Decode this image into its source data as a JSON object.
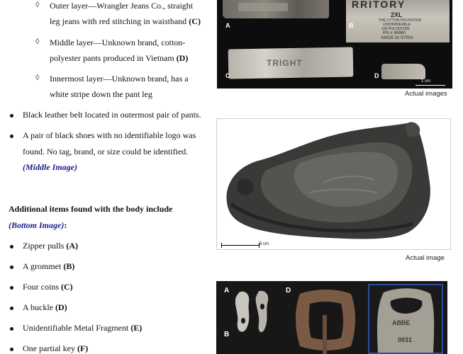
{
  "layers": [
    {
      "line1": "Outer layer—Wrangler Jeans Co., straight",
      "line2": "leg jeans with red stitching in waistband ",
      "ref": "(C)"
    },
    {
      "line1": "Middle layer—Unknown brand, cotton-",
      "line2": "polyester pants produced in Vietnam ",
      "ref": "(D)"
    },
    {
      "line1": "Innermost layer—Unknown brand, has a",
      "line2": "white stripe down the pant leg",
      "ref": ""
    }
  ],
  "belt": "Black leather belt located in outermost pair of pants.",
  "shoes": {
    "line1": "A pair of black shoes with no identifiable logo was",
    "line2": "found. No tag, brand, or size could be identified.",
    "ref": "(Middle Image)"
  },
  "additional": {
    "heading": "Additional items found with the body include",
    "ref": "(Bottom Image)",
    "colon": ":"
  },
  "items": [
    {
      "text": "Zipper pulls ",
      "ref": "(A)"
    },
    {
      "text": "A grommet ",
      "ref": "(B)"
    },
    {
      "text": "Four coins ",
      "ref": "(C)"
    },
    {
      "text": "A buckle ",
      "ref": "(D)"
    },
    {
      "text": "Unidentifiable Metal Fragment ",
      "ref": "(E)"
    },
    {
      "text": "One partial key ",
      "ref": "(F)"
    }
  ],
  "top_image": {
    "panels": [
      "A",
      "B",
      "C",
      "D"
    ],
    "tag_text": {
      "b1": "RRITORY",
      "b2": "2XL",
      "b3": "THE LITTON POLYESTER",
      "b4": "UNSHRINKABLE",
      "b5": "100 POLYESTER",
      "b6": "RN # 86960",
      "b7": "MADE IN SYRIA",
      "c1": "TRIGHT"
    },
    "scale": "1 cm",
    "caption": "Actual images"
  },
  "middle_image": {
    "scale": "5 cm",
    "caption": "Actual image"
  },
  "bottom_image": {
    "panels": [
      "A",
      "B",
      "D"
    ],
    "key_text": {
      "k1": "ABBE",
      "k2": "0031"
    }
  }
}
